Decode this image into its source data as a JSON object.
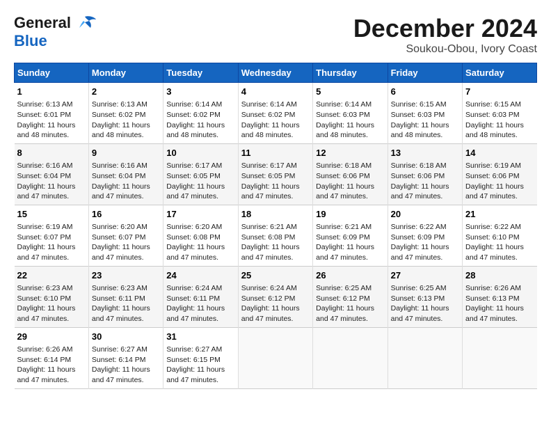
{
  "logo": {
    "line1": "General",
    "line2": "Blue"
  },
  "title": "December 2024",
  "subtitle": "Soukou-Obou, Ivory Coast",
  "days_of_week": [
    "Sunday",
    "Monday",
    "Tuesday",
    "Wednesday",
    "Thursday",
    "Friday",
    "Saturday"
  ],
  "weeks": [
    [
      {
        "day": "1",
        "info": "Sunrise: 6:13 AM\nSunset: 6:01 PM\nDaylight: 11 hours\nand 48 minutes."
      },
      {
        "day": "2",
        "info": "Sunrise: 6:13 AM\nSunset: 6:02 PM\nDaylight: 11 hours\nand 48 minutes."
      },
      {
        "day": "3",
        "info": "Sunrise: 6:14 AM\nSunset: 6:02 PM\nDaylight: 11 hours\nand 48 minutes."
      },
      {
        "day": "4",
        "info": "Sunrise: 6:14 AM\nSunset: 6:02 PM\nDaylight: 11 hours\nand 48 minutes."
      },
      {
        "day": "5",
        "info": "Sunrise: 6:14 AM\nSunset: 6:03 PM\nDaylight: 11 hours\nand 48 minutes."
      },
      {
        "day": "6",
        "info": "Sunrise: 6:15 AM\nSunset: 6:03 PM\nDaylight: 11 hours\nand 48 minutes."
      },
      {
        "day": "7",
        "info": "Sunrise: 6:15 AM\nSunset: 6:03 PM\nDaylight: 11 hours\nand 48 minutes."
      }
    ],
    [
      {
        "day": "8",
        "info": "Sunrise: 6:16 AM\nSunset: 6:04 PM\nDaylight: 11 hours\nand 47 minutes."
      },
      {
        "day": "9",
        "info": "Sunrise: 6:16 AM\nSunset: 6:04 PM\nDaylight: 11 hours\nand 47 minutes."
      },
      {
        "day": "10",
        "info": "Sunrise: 6:17 AM\nSunset: 6:05 PM\nDaylight: 11 hours\nand 47 minutes."
      },
      {
        "day": "11",
        "info": "Sunrise: 6:17 AM\nSunset: 6:05 PM\nDaylight: 11 hours\nand 47 minutes."
      },
      {
        "day": "12",
        "info": "Sunrise: 6:18 AM\nSunset: 6:06 PM\nDaylight: 11 hours\nand 47 minutes."
      },
      {
        "day": "13",
        "info": "Sunrise: 6:18 AM\nSunset: 6:06 PM\nDaylight: 11 hours\nand 47 minutes."
      },
      {
        "day": "14",
        "info": "Sunrise: 6:19 AM\nSunset: 6:06 PM\nDaylight: 11 hours\nand 47 minutes."
      }
    ],
    [
      {
        "day": "15",
        "info": "Sunrise: 6:19 AM\nSunset: 6:07 PM\nDaylight: 11 hours\nand 47 minutes."
      },
      {
        "day": "16",
        "info": "Sunrise: 6:20 AM\nSunset: 6:07 PM\nDaylight: 11 hours\nand 47 minutes."
      },
      {
        "day": "17",
        "info": "Sunrise: 6:20 AM\nSunset: 6:08 PM\nDaylight: 11 hours\nand 47 minutes."
      },
      {
        "day": "18",
        "info": "Sunrise: 6:21 AM\nSunset: 6:08 PM\nDaylight: 11 hours\nand 47 minutes."
      },
      {
        "day": "19",
        "info": "Sunrise: 6:21 AM\nSunset: 6:09 PM\nDaylight: 11 hours\nand 47 minutes."
      },
      {
        "day": "20",
        "info": "Sunrise: 6:22 AM\nSunset: 6:09 PM\nDaylight: 11 hours\nand 47 minutes."
      },
      {
        "day": "21",
        "info": "Sunrise: 6:22 AM\nSunset: 6:10 PM\nDaylight: 11 hours\nand 47 minutes."
      }
    ],
    [
      {
        "day": "22",
        "info": "Sunrise: 6:23 AM\nSunset: 6:10 PM\nDaylight: 11 hours\nand 47 minutes."
      },
      {
        "day": "23",
        "info": "Sunrise: 6:23 AM\nSunset: 6:11 PM\nDaylight: 11 hours\nand 47 minutes."
      },
      {
        "day": "24",
        "info": "Sunrise: 6:24 AM\nSunset: 6:11 PM\nDaylight: 11 hours\nand 47 minutes."
      },
      {
        "day": "25",
        "info": "Sunrise: 6:24 AM\nSunset: 6:12 PM\nDaylight: 11 hours\nand 47 minutes."
      },
      {
        "day": "26",
        "info": "Sunrise: 6:25 AM\nSunset: 6:12 PM\nDaylight: 11 hours\nand 47 minutes."
      },
      {
        "day": "27",
        "info": "Sunrise: 6:25 AM\nSunset: 6:13 PM\nDaylight: 11 hours\nand 47 minutes."
      },
      {
        "day": "28",
        "info": "Sunrise: 6:26 AM\nSunset: 6:13 PM\nDaylight: 11 hours\nand 47 minutes."
      }
    ],
    [
      {
        "day": "29",
        "info": "Sunrise: 6:26 AM\nSunset: 6:14 PM\nDaylight: 11 hours\nand 47 minutes."
      },
      {
        "day": "30",
        "info": "Sunrise: 6:27 AM\nSunset: 6:14 PM\nDaylight: 11 hours\nand 47 minutes."
      },
      {
        "day": "31",
        "info": "Sunrise: 6:27 AM\nSunset: 6:15 PM\nDaylight: 11 hours\nand 47 minutes."
      },
      {
        "day": "",
        "info": ""
      },
      {
        "day": "",
        "info": ""
      },
      {
        "day": "",
        "info": ""
      },
      {
        "day": "",
        "info": ""
      }
    ]
  ]
}
